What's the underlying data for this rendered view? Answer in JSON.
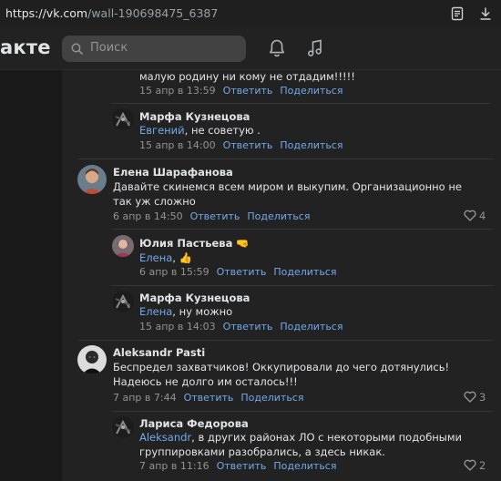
{
  "browser": {
    "url_host": "https://vk.com",
    "url_rest": "/wall-190698475_6387"
  },
  "header": {
    "logo": "акте",
    "search_placeholder": "Поиск"
  },
  "actions": {
    "reply": "Ответить",
    "share": "Поделиться"
  },
  "comments": [
    {
      "text": "малую родину ни кому не отдадим!!!!!",
      "date": "15 апр в 13:59"
    },
    {
      "author": "Марфа Кузнецова",
      "mention": "Евгений",
      "text": ", не советую .",
      "date": "15 апр в 14:00"
    },
    {
      "author": "Елена Шарафанова",
      "text": "Давайте скинемся всем миром и выкупим. Организационно не так уж сложно",
      "date": "6 апр в 14:50",
      "likes": "4"
    },
    {
      "author": "Юлия Пастьева",
      "mention": "Елена",
      "text": ", 👍",
      "date": "6 апр в 15:59"
    },
    {
      "author": "Марфа Кузнецова",
      "mention": "Елена",
      "text": ", ну можно",
      "date": "15 апр в 14:03"
    },
    {
      "author": "Aleksandr Pasti",
      "text": "Беспредел захватчиков! Оккупировали до чего дотянулись! Надеюсь не долго им осталось!!!",
      "date": "7 апр в 7:44",
      "likes": "3"
    },
    {
      "author": "Лариса Федорова",
      "mention": "Aleksandr",
      "text": ", в других районах ЛО с некоторыми подобными группировками разобрались, а здесь никак.",
      "date": "7 апр в 11:16",
      "likes": "2"
    }
  ],
  "colors": {
    "link": "#71aaeb",
    "secondary": "#939393",
    "panel": "#222222",
    "background": "#191919"
  }
}
